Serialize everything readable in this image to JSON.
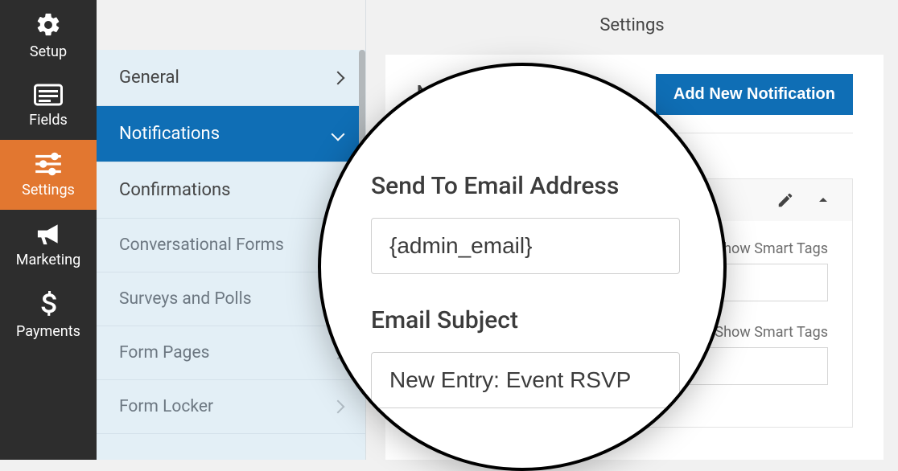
{
  "vnav": {
    "setup": "Setup",
    "fields": "Fields",
    "settings": "Settings",
    "marketing": "Marketing",
    "payments": "Payments"
  },
  "sidebar": {
    "general": "General",
    "notifications": "Notifications",
    "confirmations": "Confirmations",
    "conversational": "Conversational Forms",
    "surveys": "Surveys and Polls",
    "formpages": "Form Pages",
    "formlocker": "Form Locker"
  },
  "main": {
    "header": "Settings",
    "section": "Notifications",
    "add_btn": "Add New Notification"
  },
  "card": {
    "smart_tags": "Show Smart Tags"
  },
  "lens": {
    "sendto_label": "Send To Email Address",
    "sendto_value": "{admin_email}",
    "subject_label": "Email Subject",
    "subject_value": "New Entry: Event RSVP"
  }
}
